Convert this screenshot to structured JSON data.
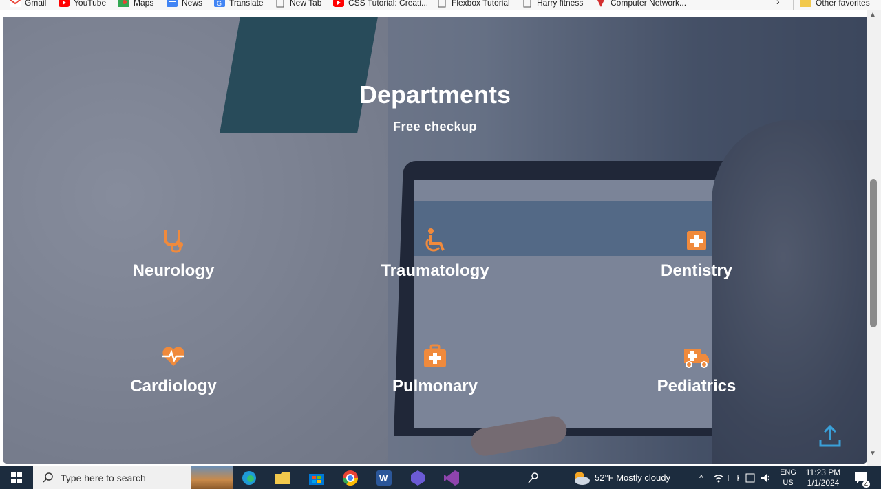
{
  "bookmarks": {
    "items": [
      {
        "label": "Gmail",
        "icon": "gmail-icon"
      },
      {
        "label": "YouTube",
        "icon": "youtube-icon"
      },
      {
        "label": "Maps",
        "icon": "maps-icon"
      },
      {
        "label": "News",
        "icon": "news-icon"
      },
      {
        "label": "Translate",
        "icon": "translate-icon"
      },
      {
        "label": "New Tab",
        "icon": "page-icon"
      },
      {
        "label": "CSS Tutorial: Creati...",
        "icon": "youtube-icon"
      },
      {
        "label": "Flexbox Tutorial",
        "icon": "page-icon"
      },
      {
        "label": "Harry fitness",
        "icon": "page-icon"
      },
      {
        "label": "Computer Network...",
        "icon": "brand-icon"
      }
    ],
    "other_favorites": "Other favorites"
  },
  "hero": {
    "title": "Departments",
    "subtitle": "Free checkup",
    "accent_color": "#f08a3c",
    "departments": [
      {
        "label": "Neurology",
        "icon": "stethoscope-icon"
      },
      {
        "label": "Traumatology",
        "icon": "wheelchair-icon"
      },
      {
        "label": "Dentistry",
        "icon": "medical-plus-icon"
      },
      {
        "label": "Cardiology",
        "icon": "heartbeat-icon"
      },
      {
        "label": "Pulmonary",
        "icon": "medkit-icon"
      },
      {
        "label": "Pediatrics",
        "icon": "ambulance-icon"
      }
    ]
  },
  "taskbar": {
    "search_placeholder": "Type here to search",
    "weather": "52°F  Mostly cloudy",
    "language": "ENG",
    "region": "US",
    "time": "11:23 PM",
    "date": "1/1/2024",
    "notifications": "4"
  }
}
